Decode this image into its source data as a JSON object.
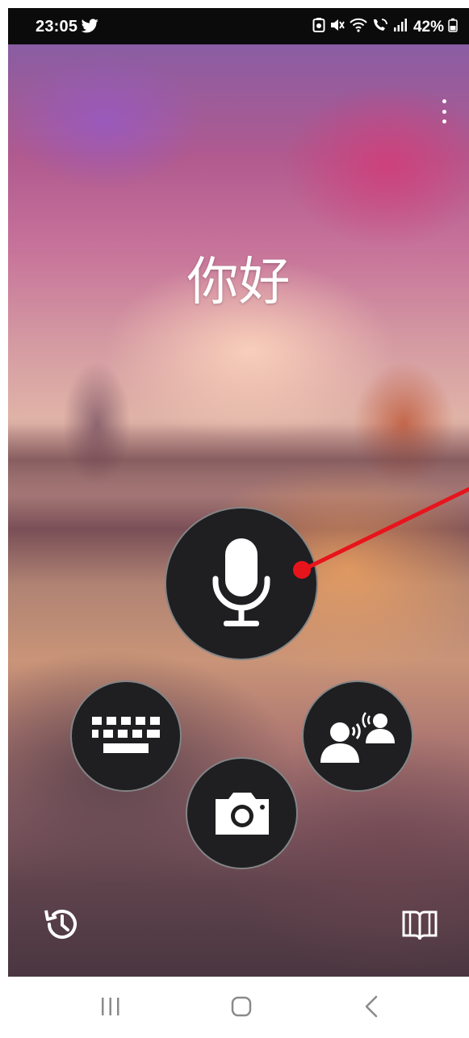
{
  "status_bar": {
    "time": "23:05",
    "battery_percent": "42%",
    "left_icons": [
      "twitter-bird-icon"
    ],
    "right_icons": [
      "battery-saver-icon",
      "mute-icon",
      "wifi-icon",
      "wifi-calling-icon",
      "signal-icon",
      "battery-icon"
    ]
  },
  "main": {
    "greeting_text": "你好"
  },
  "actions": {
    "voice": "microphone-icon",
    "keyboard": "keyboard-icon",
    "camera": "camera-icon",
    "conversation": "conversation-icon"
  },
  "bottom": {
    "history": "history-icon",
    "phrasebook": "phrasebook-icon"
  },
  "navbar": {
    "recent": "recent-apps-icon",
    "home": "home-icon",
    "back": "back-icon"
  },
  "colors": {
    "button_fill": "#1f1f22",
    "annotation": "#e8141c",
    "status_bar": "#0b0b0c"
  }
}
